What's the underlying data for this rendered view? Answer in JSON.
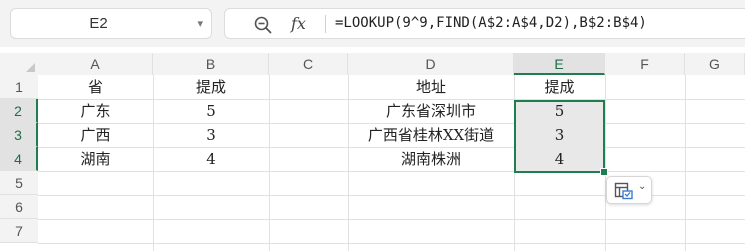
{
  "formula_bar": {
    "name_box": "E2",
    "fx_label": "fx",
    "formula": "=LOOKUP(9^9,FIND(A$2:A$4,D2),B$2:B$4)"
  },
  "columns": [
    "A",
    "B",
    "C",
    "D",
    "E",
    "F",
    "G"
  ],
  "rows": [
    "1",
    "2",
    "3",
    "4",
    "5",
    "6",
    "7"
  ],
  "cells": {
    "A1": "省",
    "B1": "提成",
    "D1": "地址",
    "E1": "提成",
    "A2": "广东",
    "B2": "5",
    "D2": "广东省深圳市",
    "E2": "5",
    "A3": "广西",
    "B3": "3",
    "D3": "广西省桂林XX街道",
    "E3": "3",
    "A4": "湖南",
    "B4": "4",
    "D4": "湖南株洲",
    "E4": "4"
  },
  "selection": {
    "range": "E2:E4",
    "active_cell": "E2"
  },
  "colors": {
    "selection_border": "#1e7e4f",
    "header_bg": "#f3f3f3",
    "selected_header_bg": "#e2e2e2"
  },
  "icons": {
    "zoom": "zoom-formula-icon",
    "paste_options": "paste-options-icon"
  }
}
